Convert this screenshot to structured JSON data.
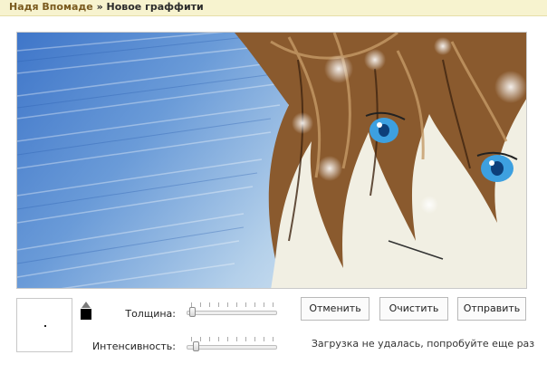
{
  "breadcrumb": {
    "user": "Надя Впомаде",
    "separator": "»",
    "title": "Новое граффити"
  },
  "canvas": {
    "description_icon": "graffiti-drawing-canvas"
  },
  "tools": {
    "thickness_label": "Толщина:",
    "intensity_label": "Интенсивность:",
    "thickness_level": 0.03,
    "intensity_level": 0.08,
    "current_color": "#000000"
  },
  "buttons": {
    "cancel": "Отменить",
    "clear": "Очистить",
    "send": "Отправить"
  },
  "status_text": "Загрузка не удалась, попробуйте еще раз"
}
